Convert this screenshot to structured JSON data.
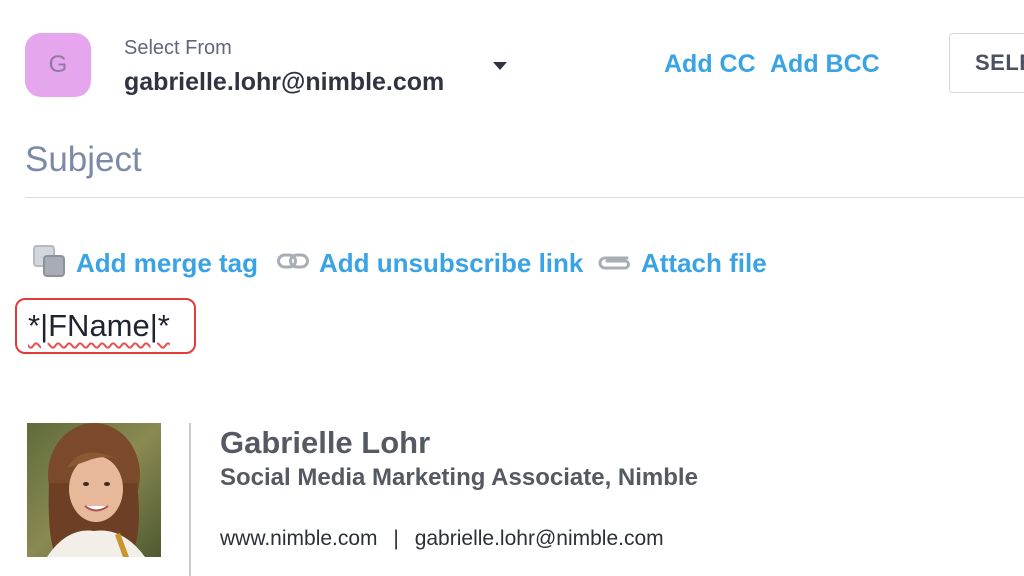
{
  "sender": {
    "avatar_initial": "G",
    "label": "Select From",
    "email": "gabrielle.lohr@nimble.com"
  },
  "recipients": {
    "add_cc": "Add CC",
    "add_bcc": "Add BCC"
  },
  "select_button": "SELE",
  "subject": {
    "placeholder": "Subject"
  },
  "toolbar": {
    "merge_tag": "Add merge tag",
    "unsubscribe": "Add unsubscribe link",
    "attach": "Attach file"
  },
  "body": {
    "merge_field": "*|FName|*"
  },
  "signature": {
    "name": "Gabrielle Lohr",
    "title": "Social Media Marketing Associate, Nimble",
    "website": "www.nimble.com",
    "separator": "|",
    "email": "gabrielle.lohr@nimble.com"
  },
  "colors": {
    "link_blue": "#3aa3e3",
    "avatar_bg": "#e6a6ee",
    "highlight_red": "#e23b3b"
  },
  "icons": [
    "chevron-down-icon",
    "merge-tag-icon",
    "link-icon",
    "paperclip-icon"
  ]
}
